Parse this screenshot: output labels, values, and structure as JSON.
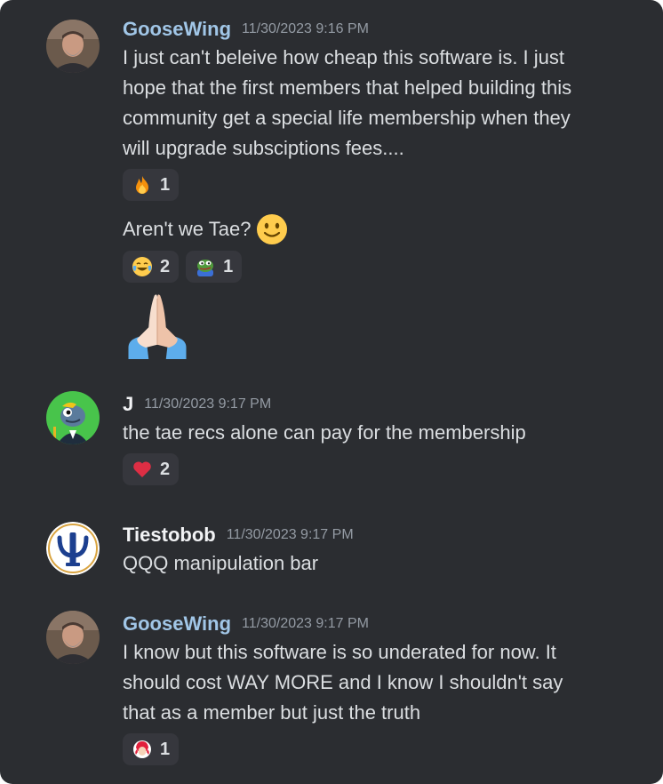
{
  "messages": [
    {
      "author": "GooseWing",
      "timestamp": "11/30/2023 9:16 PM",
      "lines": [
        "I just can't beleive how cheap this software is.  I just",
        "hope that the first members that helped building this",
        "community get a special life membership when they",
        "will upgrade subsciptions fees...."
      ],
      "reactions": [
        {
          "emoji": "fire-emoji",
          "count": "1"
        }
      ],
      "followups": [
        {
          "text": "Aren't we Tae?",
          "inline_emoji": "slightly-smiling-face-emoji",
          "reactions": [
            {
              "emoji": "joy-emoji",
              "count": "2"
            },
            {
              "emoji": "pepe-frog-emoji",
              "count": "1"
            }
          ]
        },
        {
          "big_emoji": "folded-hands-emoji"
        }
      ]
    },
    {
      "author": "J",
      "timestamp": "11/30/2023 9:17 PM",
      "lines": [
        "the tae recs alone can pay for the membership"
      ],
      "reactions": [
        {
          "emoji": "red-heart-emoji",
          "count": "2"
        }
      ]
    },
    {
      "author": "Tiestobob",
      "timestamp": "11/30/2023 9:17 PM",
      "lines": [
        "QQQ manipulation bar"
      ]
    },
    {
      "author": "GooseWing",
      "timestamp": "11/30/2023 9:17 PM",
      "lines": [
        "I know but this software is so underated for now.  It",
        "should cost WAY MORE and I know I shouldn't say",
        "that as a member but just the truth"
      ],
      "reactions": [
        {
          "emoji": "wendys-emoji",
          "count": "1"
        }
      ]
    }
  ],
  "colors": {
    "background": "#2b2d31",
    "goosewing_name": "#a1c6e7",
    "default_name": "#f2f3f5",
    "message_text": "#dbdee1",
    "timestamp": "#949ba4",
    "reaction_bg": "#36373d"
  }
}
